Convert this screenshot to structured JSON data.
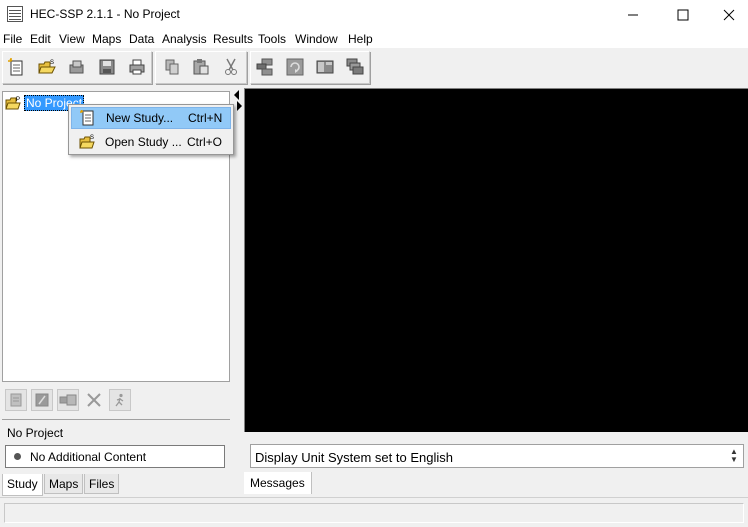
{
  "window": {
    "title": "HEC-SSP 2.1.1 - No Project",
    "controls": [
      "minimize",
      "maximize",
      "close"
    ]
  },
  "menubar": [
    "File",
    "Edit",
    "View",
    "Maps",
    "Data",
    "Analysis",
    "Results",
    "Tools",
    "Window",
    "Help"
  ],
  "toolbar": {
    "groups": [
      [
        "new-study-icon",
        "open-study-icon",
        "open-existing-icon",
        "save-icon",
        "print-icon"
      ],
      [
        "copy-icon",
        "paste-icon",
        "cut-icon"
      ],
      [
        "network-icon",
        "refresh-icon",
        "tile-icon",
        "cascade-icon"
      ]
    ]
  },
  "tree": {
    "root_label": "No Project",
    "root_icon": "folder-icon"
  },
  "context_menu": {
    "items": [
      {
        "label": "New Study...",
        "shortcut": "Ctrl+N",
        "icon": "new-document-icon",
        "highlighted": true
      },
      {
        "label": "Open Study ...",
        "shortcut": "Ctrl+O",
        "icon": "open-folder-icon",
        "highlighted": false
      }
    ]
  },
  "panel_toolbar": [
    "add-icon",
    "edit-icon",
    "move-icon",
    "delete-icon",
    "run-icon"
  ],
  "properties": {
    "title": "No Project",
    "content": "No Additional Content"
  },
  "left_tabs": {
    "items": [
      "Study",
      "Maps",
      "Files"
    ],
    "active": "Study"
  },
  "messages": {
    "text": "Display Unit System set to English",
    "tab_label": "Messages"
  },
  "colors": {
    "selection": "#3399ff",
    "menu_highlight": "#91c9f7",
    "desktop": "#000000"
  }
}
